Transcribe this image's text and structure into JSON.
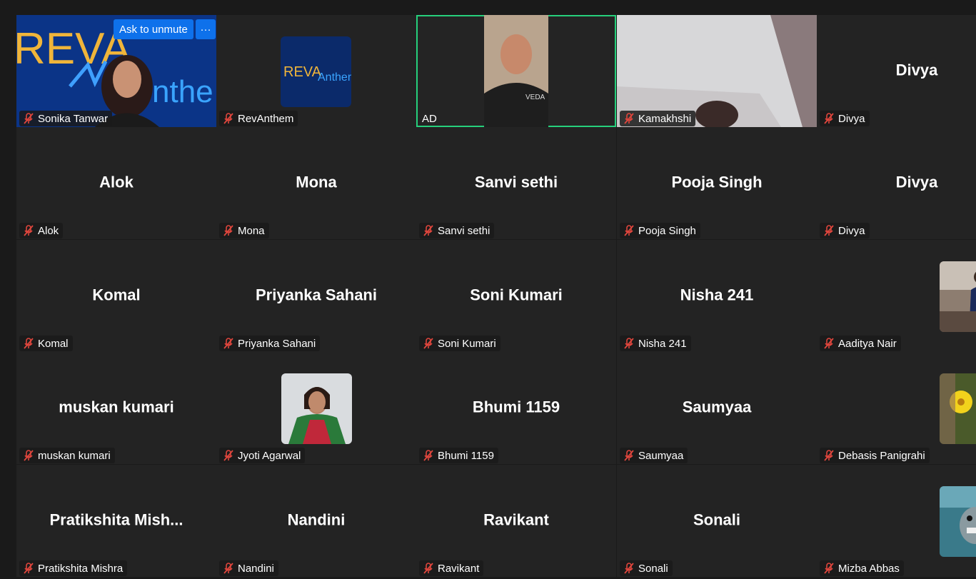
{
  "controls": {
    "ask_to_unmute": "Ask to unmute",
    "more": "···"
  },
  "logo_text": {
    "reva": "REVA",
    "anthem": "Anthem",
    "shirt": "VEDA"
  },
  "participants": [
    {
      "display": "",
      "label": "Sonika Tanwar"
    },
    {
      "display": "",
      "label": "RevAnthem"
    },
    {
      "display": "",
      "label": "AD"
    },
    {
      "display": "",
      "label": "Kamakhshi"
    },
    {
      "display": "Divya",
      "label": "Divya"
    },
    {
      "display": "Alok",
      "label": "Alok"
    },
    {
      "display": "Mona",
      "label": "Mona"
    },
    {
      "display": "Sanvi sethi",
      "label": "Sanvi sethi"
    },
    {
      "display": "Pooja Singh",
      "label": "Pooja Singh"
    },
    {
      "display": "Divya",
      "label": "Divya"
    },
    {
      "display": "Komal",
      "label": "Komal"
    },
    {
      "display": "Priyanka Sahani",
      "label": "Priyanka Sahani"
    },
    {
      "display": "Soni Kumari",
      "label": "Soni Kumari"
    },
    {
      "display": "Nisha 241",
      "label": "Nisha 241"
    },
    {
      "display": "",
      "label": "Aaditya Nair"
    },
    {
      "display": "muskan kumari",
      "label": "muskan kumari"
    },
    {
      "display": "",
      "label": "Jyoti Agarwal"
    },
    {
      "display": "Bhumi 1159",
      "label": "Bhumi 1159"
    },
    {
      "display": "Saumyaa",
      "label": "Saumyaa"
    },
    {
      "display": "",
      "label": "Debasis Panigrahi"
    },
    {
      "display": "Pratikshita  Mish...",
      "label": "Pratikshita Mishra"
    },
    {
      "display": "Nandini",
      "label": "Nandini"
    },
    {
      "display": "Ravikant",
      "label": "Ravikant"
    },
    {
      "display": "Sonali",
      "label": "Sonali"
    },
    {
      "display": "",
      "label": "Mizba Abbas"
    }
  ]
}
